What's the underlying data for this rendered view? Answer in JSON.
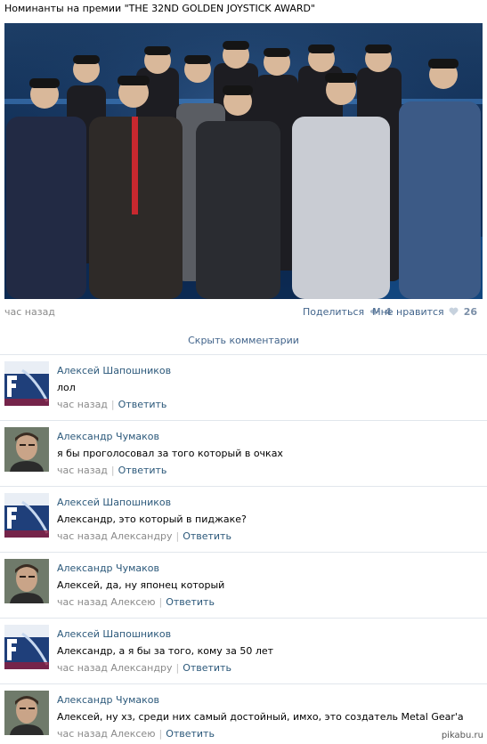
{
  "post": {
    "title": "Номинанты на премии \"THE 32ND GOLDEN JOYSTICK AWARD\"",
    "time": "час назад",
    "share_label": "Поделиться",
    "share_count": "4",
    "like_label": "Мне нравится",
    "like_count": "26",
    "share_icon": "megaphone-icon",
    "like_icon": "heart-icon"
  },
  "hide_comments": "Скрыть комментарии",
  "comments": [
    {
      "author": "Алексей Шапошников",
      "text": "лол",
      "time": "час назад",
      "reply_to": "",
      "reply": "Ответить",
      "avatar": "avatar-alexey"
    },
    {
      "author": "Александр Чумаков",
      "text": "я бы проголосовал за того который в очках",
      "time": "час назад",
      "reply_to": "",
      "reply": "Ответить",
      "avatar": "avatar-alexander"
    },
    {
      "author": "Алексей Шапошников",
      "text": "Александр, это который в пиджаке?",
      "time": "час назад",
      "reply_to": "Александру",
      "reply": "Ответить",
      "avatar": "avatar-alexey"
    },
    {
      "author": "Александр Чумаков",
      "text": "Алексей, да, ну японец который",
      "time": "час назад",
      "reply_to": "Алексею",
      "reply": "Ответить",
      "avatar": "avatar-alexander"
    },
    {
      "author": "Алексей Шапошников",
      "text": "Александр, а я бы за того, кому за 50 лет",
      "time": "час назад",
      "reply_to": "Александру",
      "reply": "Ответить",
      "avatar": "avatar-alexey"
    },
    {
      "author": "Александр Чумаков",
      "text": "Алексей, ну хз, среди них самый достойный, имхо, это создатель Metal Gear'a",
      "time": "час назад",
      "reply_to": "Алексею",
      "reply": "Ответить",
      "avatar": "avatar-alexander"
    }
  ],
  "watermark": "pikabu.ru",
  "colors": {
    "link": "#2b587a",
    "muted": "#8a8a8a",
    "divider": "#e1e6ec"
  }
}
